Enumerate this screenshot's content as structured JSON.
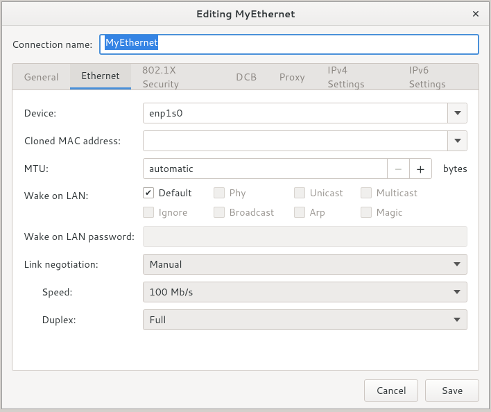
{
  "window": {
    "title": "Editing MyEthernet"
  },
  "connection_name": {
    "label": "Connection name:",
    "value": "MyEthernet"
  },
  "tabs": [
    {
      "label": "General"
    },
    {
      "label": "Ethernet"
    },
    {
      "label": "802.1X Security"
    },
    {
      "label": "DCB"
    },
    {
      "label": "Proxy"
    },
    {
      "label": "IPv4 Settings"
    },
    {
      "label": "IPv6 Settings"
    }
  ],
  "active_tab": 1,
  "ethernet": {
    "device": {
      "label": "Device:",
      "value": "enp1s0"
    },
    "cloned_mac": {
      "label": "Cloned MAC address:",
      "value": ""
    },
    "mtu": {
      "label": "MTU:",
      "value": "automatic",
      "unit": "bytes"
    },
    "wol": {
      "label": "Wake on LAN:",
      "options": [
        {
          "label": "Default",
          "checked": true,
          "enabled": true
        },
        {
          "label": "Phy",
          "checked": false,
          "enabled": false
        },
        {
          "label": "Unicast",
          "checked": false,
          "enabled": false
        },
        {
          "label": "Multicast",
          "checked": false,
          "enabled": false
        },
        {
          "label": "Ignore",
          "checked": false,
          "enabled": false
        },
        {
          "label": "Broadcast",
          "checked": false,
          "enabled": false
        },
        {
          "label": "Arp",
          "checked": false,
          "enabled": false
        },
        {
          "label": "Magic",
          "checked": false,
          "enabled": false
        }
      ]
    },
    "wol_password": {
      "label": "Wake on LAN password:",
      "value": ""
    },
    "link_negotiation": {
      "label": "Link negotiation:",
      "value": "Manual"
    },
    "speed": {
      "label": "Speed:",
      "value": "100 Mb/s"
    },
    "duplex": {
      "label": "Duplex:",
      "value": "Full"
    }
  },
  "buttons": {
    "cancel": "Cancel",
    "save": "Save"
  }
}
